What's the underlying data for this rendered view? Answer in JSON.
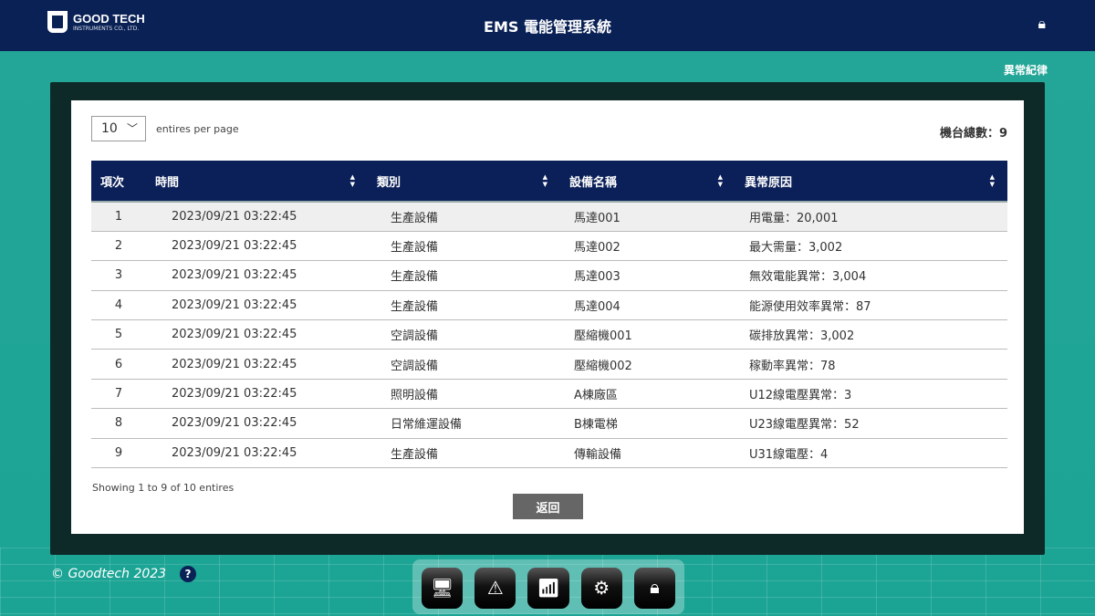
{
  "header": {
    "logo_name": "GOOD TECH",
    "logo_sub": "INSTRUMENTS CO., LTD.",
    "title": "EMS 電能管理系統",
    "lock_icon": "lock-icon"
  },
  "record_link": "異常紀律",
  "controls": {
    "page_size": "10",
    "per_page_label": "entires per page",
    "count_label": "機台總數：9"
  },
  "table": {
    "headers": [
      "項次",
      "時間",
      "類別",
      "設備名稱",
      "異常原因"
    ],
    "rows": [
      [
        "1",
        "2023/09/21 03:22:45",
        "生產設備",
        "馬達001",
        "用電量：20,001"
      ],
      [
        "2",
        "2023/09/21 03:22:45",
        "生產設備",
        "馬達002",
        "最大需量：3,002"
      ],
      [
        "3",
        "2023/09/21 03:22:45",
        "生產設備",
        "馬達003",
        "無效電能異常：3,004"
      ],
      [
        "4",
        "2023/09/21 03:22:45",
        "生產設備",
        "馬達004",
        "能源使用效率異常：87"
      ],
      [
        "5",
        "2023/09/21 03:22:45",
        "空調設備",
        "壓縮機001",
        "碳排放異常：3,002"
      ],
      [
        "6",
        "2023/09/21 03:22:45",
        "空調設備",
        "壓縮機002",
        "稼動率異常：78"
      ],
      [
        "7",
        "2023/09/21 03:22:45",
        "照明設備",
        "A棟廠區",
        "U12線電壓異常：3"
      ],
      [
        "8",
        "2023/09/21 03:22:45",
        "日常維運設備",
        "B棟電梯",
        "U23線電壓異常：52"
      ],
      [
        "9",
        "2023/09/21 03:22:45",
        "生產設備",
        "傳輸設備",
        "U31線電壓：4"
      ]
    ]
  },
  "showing": "Showing 1 to 9 of 10 entires",
  "back_label": "返回",
  "footer": {
    "copyright": "© Goodtech 2023",
    "help": "?"
  },
  "dock": [
    "monitor-icon",
    "warning-icon",
    "chart-icon",
    "gear-icon",
    "lock-icon"
  ]
}
